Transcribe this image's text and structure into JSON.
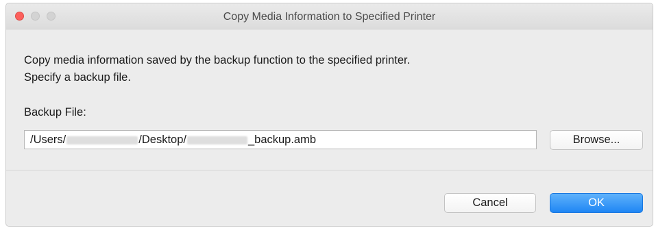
{
  "window": {
    "title": "Copy Media Information to Specified Printer"
  },
  "dialog": {
    "description_line1": "Copy media information saved by the backup function to the specified printer.",
    "description_line2": "Specify a backup file.",
    "backup_file_label": "Backup File:",
    "path": {
      "prefix": "/Users/",
      "middle": "/Desktop/",
      "suffix": "_backup.amb"
    },
    "browse_label": "Browse..."
  },
  "footer": {
    "cancel_label": "Cancel",
    "ok_label": "OK"
  },
  "colors": {
    "close": "#fc605c",
    "accent": "#1f86f4",
    "window_bg": "#ececec"
  }
}
